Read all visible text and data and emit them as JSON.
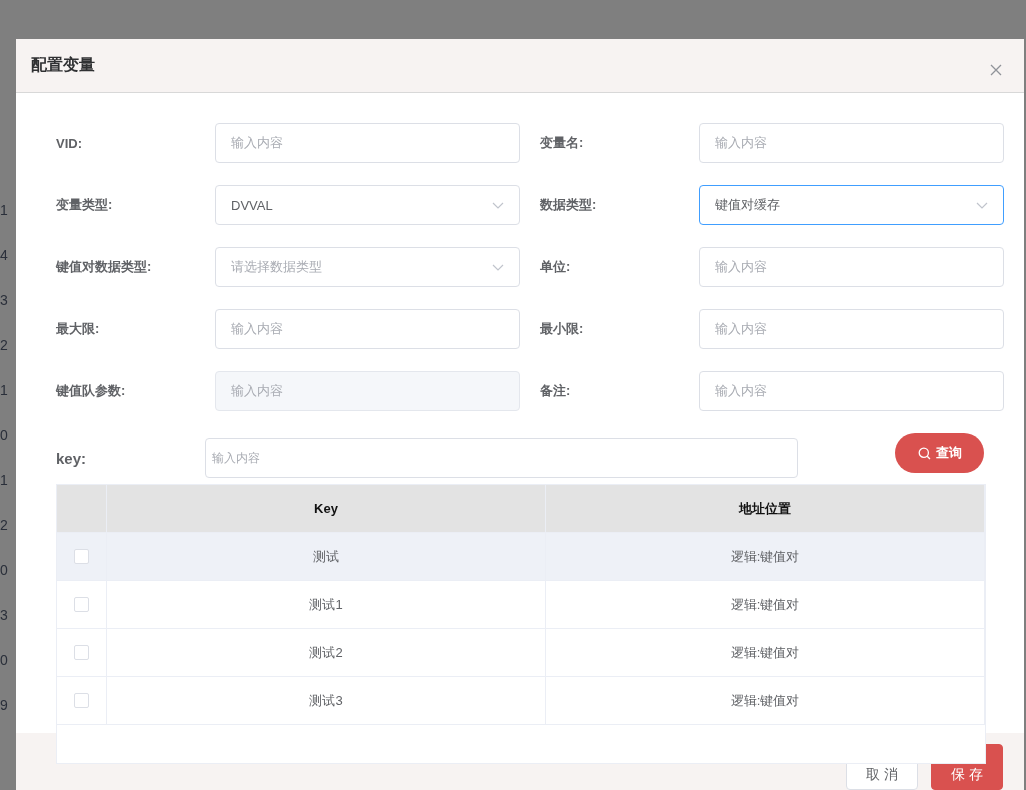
{
  "background_table": {
    "cells": [
      "1",
      "4",
      "3",
      "2",
      "1",
      "0",
      "1",
      "2",
      "0",
      "3",
      "0",
      "9"
    ]
  },
  "dialog": {
    "title": "配置变量",
    "fields": [
      {
        "label": "VID:",
        "kind": "input",
        "placeholder": "输入内容",
        "focused": false
      },
      {
        "label": "变量名:",
        "kind": "input",
        "placeholder": "输入内容",
        "focused": false
      },
      {
        "label": "变量类型:",
        "kind": "select",
        "value": "DVVAL",
        "focused": false
      },
      {
        "label": "数据类型:",
        "kind": "select",
        "value": "键值对缓存",
        "focused": true
      },
      {
        "label": "键值对数据类型:",
        "kind": "select",
        "placeholder": "请选择数据类型",
        "focused": false
      },
      {
        "label": "单位:",
        "kind": "input",
        "placeholder": "输入内容",
        "focused": false
      },
      {
        "label": "最大限:",
        "kind": "input",
        "placeholder": "输入内容",
        "focused": false
      },
      {
        "label": "最小限:",
        "kind": "input",
        "placeholder": "输入内容",
        "focused": false
      },
      {
        "label": "键值队参数:",
        "kind": "disabled",
        "placeholder": "输入内容",
        "focused": false
      },
      {
        "label": "备注:",
        "kind": "input",
        "placeholder": "输入内容",
        "focused": false
      }
    ],
    "search": {
      "label": "key:",
      "placeholder": "输入内容",
      "button": "查询"
    },
    "table": {
      "columns": [
        "Key",
        "地址位置"
      ],
      "rows": [
        {
          "key": "测试",
          "address": "逻辑:键值对",
          "checked": false,
          "highlighted": true
        },
        {
          "key": "测试1",
          "address": "逻辑:键值对",
          "checked": false,
          "highlighted": false
        },
        {
          "key": "测试2",
          "address": "逻辑:键值对",
          "checked": false,
          "highlighted": false
        },
        {
          "key": "测试3",
          "address": "逻辑:键值对",
          "checked": false,
          "highlighted": false
        }
      ]
    },
    "buttons": [
      "取 消",
      "保 存"
    ]
  }
}
